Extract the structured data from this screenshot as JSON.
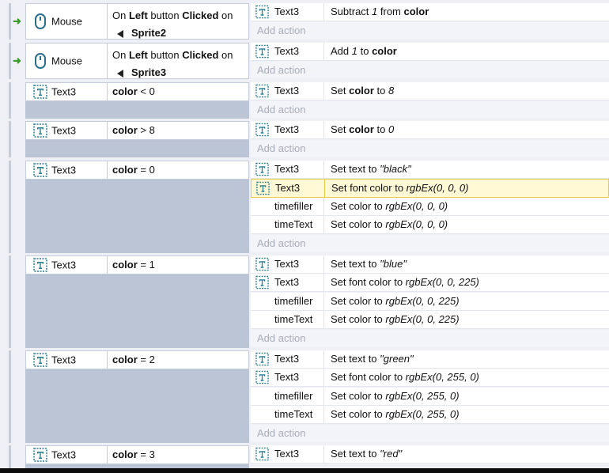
{
  "events": [
    {
      "trigger": true,
      "condition": {
        "object": "Mouse",
        "icon": "mouse-icon",
        "parts": [
          "On ",
          "Left",
          " button ",
          "Clicked",
          " on"
        ],
        "sprite": "Sprite2"
      },
      "actions": [
        {
          "object": "Text3",
          "icon": "text-object-icon",
          "text": [
            "Subtract ",
            "1",
            " from ",
            "color"
          ]
        }
      ],
      "add_action": "Add action"
    },
    {
      "trigger": true,
      "condition": {
        "object": "Mouse",
        "icon": "mouse-icon",
        "parts": [
          "On ",
          "Left",
          " button ",
          "Clicked",
          " on"
        ],
        "sprite": "Sprite3"
      },
      "actions": [
        {
          "object": "Text3",
          "icon": "text-object-icon",
          "text": [
            "Add ",
            "1",
            " to ",
            "color"
          ]
        }
      ],
      "add_action": "Add action"
    },
    {
      "condition": {
        "object": "Text3",
        "icon": "text-object-icon",
        "var": "color",
        "op": " < 0"
      },
      "actions": [
        {
          "object": "Text3",
          "icon": "text-object-icon",
          "text": [
            "Set ",
            "color",
            " to ",
            "8"
          ]
        }
      ],
      "add_action": "Add action"
    },
    {
      "condition": {
        "object": "Text3",
        "icon": "text-object-icon",
        "var": "color",
        "op": " > 8"
      },
      "actions": [
        {
          "object": "Text3",
          "icon": "text-object-icon",
          "text": [
            "Set ",
            "color",
            " to ",
            "0"
          ]
        }
      ],
      "add_action": "Add action"
    },
    {
      "condition": {
        "object": "Text3",
        "icon": "text-object-icon",
        "var": "color",
        "op": " = 0"
      },
      "actions": [
        {
          "object": "Text3",
          "icon": "text-object-icon",
          "text": [
            "Set text to ",
            "\"black\""
          ]
        },
        {
          "object": "Text3",
          "icon": "text-object-icon",
          "selected": true,
          "text": [
            "Set font color to ",
            "rgbEx(0, 0, 0)"
          ]
        },
        {
          "object": "timefiller",
          "text": [
            "Set color to ",
            "rgbEx(0, 0, 0)"
          ]
        },
        {
          "object": "timeText",
          "text": [
            "Set color to ",
            "rgbEx(0, 0, 0)"
          ]
        }
      ],
      "add_action": "Add action"
    },
    {
      "condition": {
        "object": "Text3",
        "icon": "text-object-icon",
        "var": "color",
        "op": " = 1"
      },
      "actions": [
        {
          "object": "Text3",
          "icon": "text-object-icon",
          "text": [
            "Set text to ",
            "\"blue\""
          ]
        },
        {
          "object": "Text3",
          "icon": "text-object-icon",
          "text": [
            "Set font color to ",
            "rgbEx(0, 0, 225)"
          ]
        },
        {
          "object": "timefiller",
          "text": [
            "Set color to ",
            "rgbEx(0, 0, 225)"
          ]
        },
        {
          "object": "timeText",
          "text": [
            "Set color to ",
            "rgbEx(0, 0, 225)"
          ]
        }
      ],
      "add_action": "Add action"
    },
    {
      "condition": {
        "object": "Text3",
        "icon": "text-object-icon",
        "var": "color",
        "op": " = 2"
      },
      "actions": [
        {
          "object": "Text3",
          "icon": "text-object-icon",
          "text": [
            "Set text to ",
            "\"green\""
          ]
        },
        {
          "object": "Text3",
          "icon": "text-object-icon",
          "text": [
            "Set font color to ",
            "rgbEx(0, 255, 0)"
          ]
        },
        {
          "object": "timefiller",
          "text": [
            "Set color to ",
            "rgbEx(0, 255, 0)"
          ]
        },
        {
          "object": "timeText",
          "text": [
            "Set color to ",
            "rgbEx(0, 255, 0)"
          ]
        }
      ],
      "add_action": "Add action"
    },
    {
      "condition": {
        "object": "Text3",
        "icon": "text-object-icon",
        "var": "color",
        "op": " = 3"
      },
      "actions": [
        {
          "object": "Text3",
          "icon": "text-object-icon",
          "text": [
            "Set text to ",
            "\"red\""
          ]
        }
      ]
    }
  ],
  "colors": {
    "selected_bg": "#fff9d6",
    "selected_border": "#e8c94a",
    "trigger_arrow": "#3a9a2a",
    "event_fill": "#bcc5d6"
  }
}
